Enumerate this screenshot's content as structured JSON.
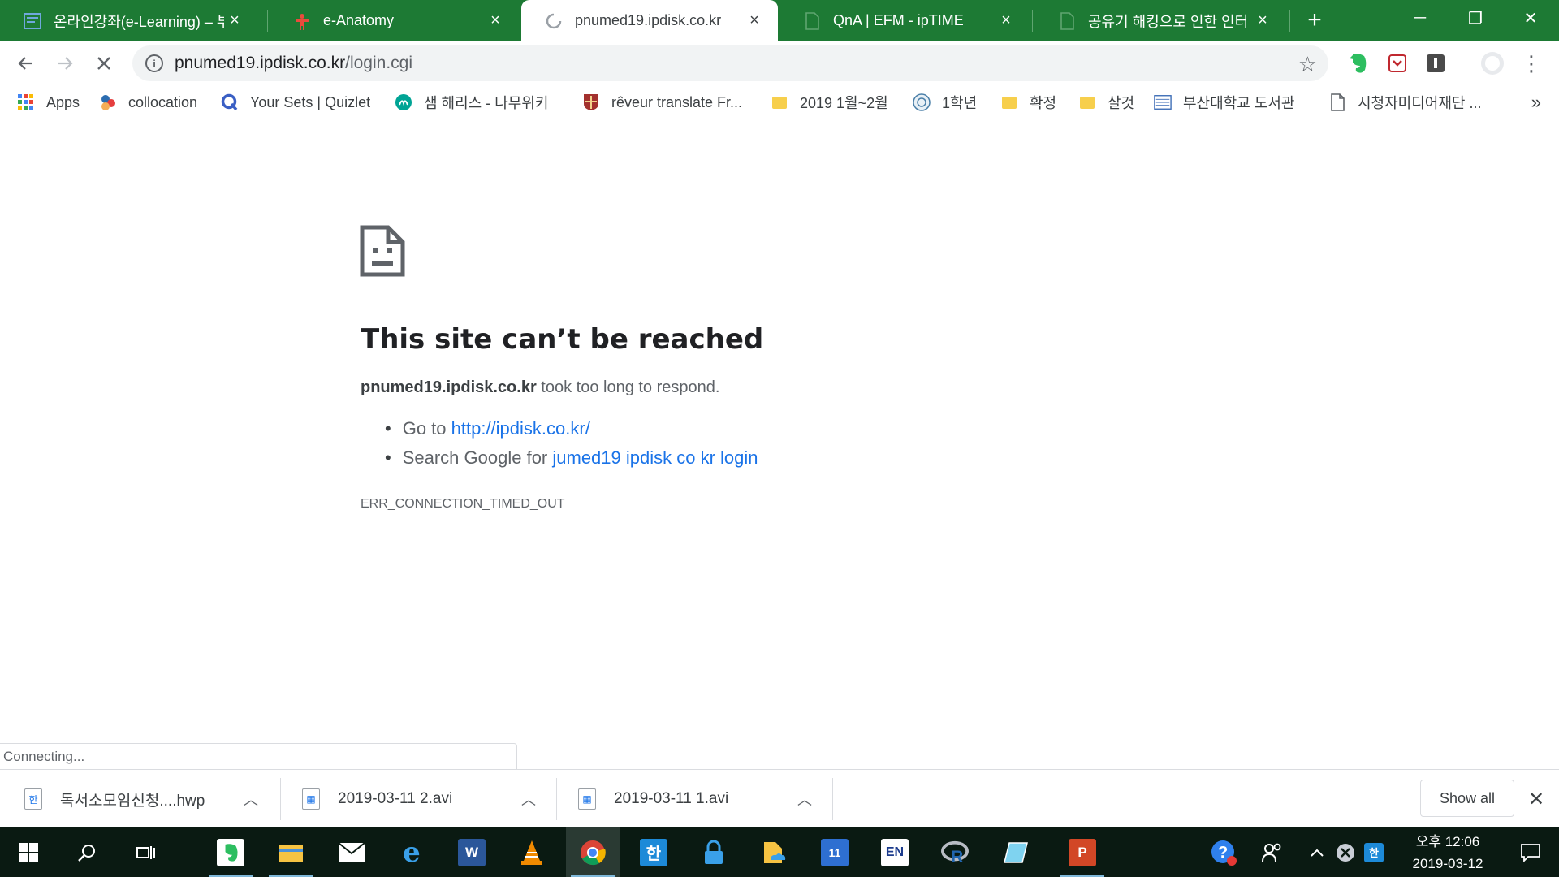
{
  "tabs": [
    {
      "title": "온라인강좌(e-Learning) – 부",
      "close": "×",
      "active": false
    },
    {
      "title": "e-Anatomy",
      "close": "×",
      "active": false
    },
    {
      "title": "pnumed19.ipdisk.co.kr",
      "close": "×",
      "active": true
    },
    {
      "title": "QnA | EFM - ipTIME",
      "close": "×",
      "active": false
    },
    {
      "title": "공유기 해킹으로 인한 인터",
      "close": "×",
      "active": false
    }
  ],
  "window_controls": {
    "new_tab": "+",
    "minimize": "─",
    "restore": "❐",
    "close": "✕"
  },
  "toolbar": {
    "url_host": "pnumed19.ipdisk.co.kr",
    "url_path": "/login.cgi",
    "info_glyph": "i",
    "star_glyph": "☆",
    "menu_glyph": "⋮"
  },
  "bookmarks": [
    {
      "label": "Apps",
      "icon": "apps-grid-icon"
    },
    {
      "label": "collocation",
      "icon": "collocation-icon"
    },
    {
      "label": "Your Sets | Quizlet",
      "icon": "quizlet-icon"
    },
    {
      "label": "샘 해리스 - 나무위키",
      "icon": "namuwiki-icon"
    },
    {
      "label": "rêveur translate Fr...",
      "icon": "cambridge-icon"
    },
    {
      "label": "2019 1월~2월",
      "icon": "folder-icon"
    },
    {
      "label": "1학년",
      "icon": "university-seal-icon"
    },
    {
      "label": "확정",
      "icon": "folder-icon"
    },
    {
      "label": "살것",
      "icon": "folder-icon"
    },
    {
      "label": "부산대학교 도서관",
      "icon": "library-icon"
    },
    {
      "label": "시청자미디어재단 ...",
      "icon": "page-icon"
    }
  ],
  "bookmarks_more": "»",
  "error": {
    "title": "This site can’t be reached",
    "host": "pnumed19.ipdisk.co.kr",
    "desc_rest": " took too long to respond.",
    "goto_prefix": "Go to ",
    "goto_link": "http://ipdisk.co.kr/",
    "search_prefix": "Search Google for ",
    "search_link": "jumed19 ipdisk co kr login",
    "code": "ERR_CONNECTION_TIMED_OUT"
  },
  "status_text": "Connecting...",
  "downloads": [
    {
      "name": "독서소모임신청....hwp",
      "icon_glyph": "한"
    },
    {
      "name": "2019-03-11 2.avi",
      "icon_glyph": "▦"
    },
    {
      "name": "2019-03-11 1.avi",
      "icon_glyph": "▦"
    }
  ],
  "show_all_label": "Show all",
  "shelf_close": "✕",
  "taskbar": {
    "calendar_day": "11",
    "ime_label": "EN",
    "clock_time": "오후 12:06",
    "clock_date": "2019-03-12"
  },
  "colors": {
    "tabstrip": "#1d7a34",
    "link": "#1a73e8",
    "taskbar": "#0a1a12"
  }
}
